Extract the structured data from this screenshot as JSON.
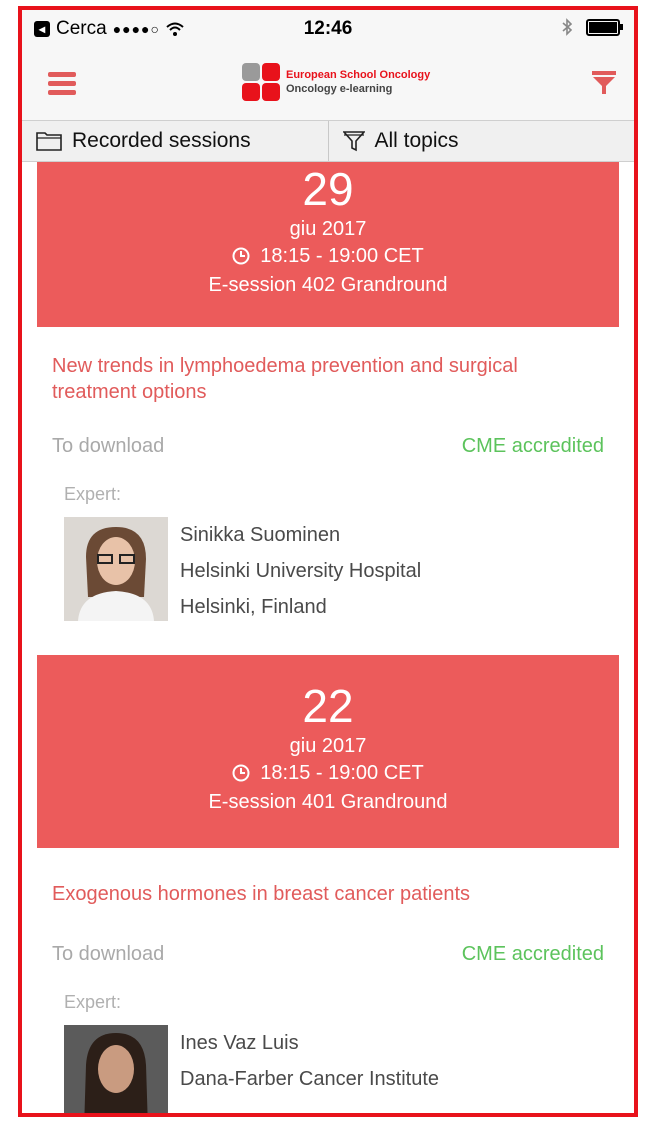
{
  "status": {
    "carrier": "Cerca",
    "signal": "●●●●○",
    "time": "12:46"
  },
  "header": {
    "logo_line1": "European School Oncology",
    "logo_line2": "Oncology e-learning"
  },
  "tabs": [
    {
      "label": "Recorded sessions"
    },
    {
      "label": "All topics"
    }
  ],
  "expert_label": "Expert:",
  "sessions": [
    {
      "day": "29",
      "month": "giu 2017",
      "time": "18:15 - 19:00 CET",
      "code": "E-session 402 Grandround",
      "title": "New trends in lymphoedema prevention and surgical treatment options",
      "download": "To download",
      "cme": "CME accredited",
      "expert": {
        "name": "Sinikka  Suominen",
        "institution": "Helsinki University Hospital",
        "location": "Helsinki, Finland"
      }
    },
    {
      "day": "22",
      "month": "giu 2017",
      "time": "18:15 - 19:00 CET",
      "code": "E-session 401 Grandround",
      "title": "Exogenous hormones in breast cancer patients",
      "download": "To download",
      "cme": "CME accredited",
      "expert": {
        "name": "Ines  Vaz Luis",
        "institution": "Dana-Farber Cancer Institute",
        "location": ""
      }
    }
  ],
  "colors": {
    "accent": "#ec5b5b",
    "cme": "#5cc35c",
    "frame": "#e8121b"
  }
}
